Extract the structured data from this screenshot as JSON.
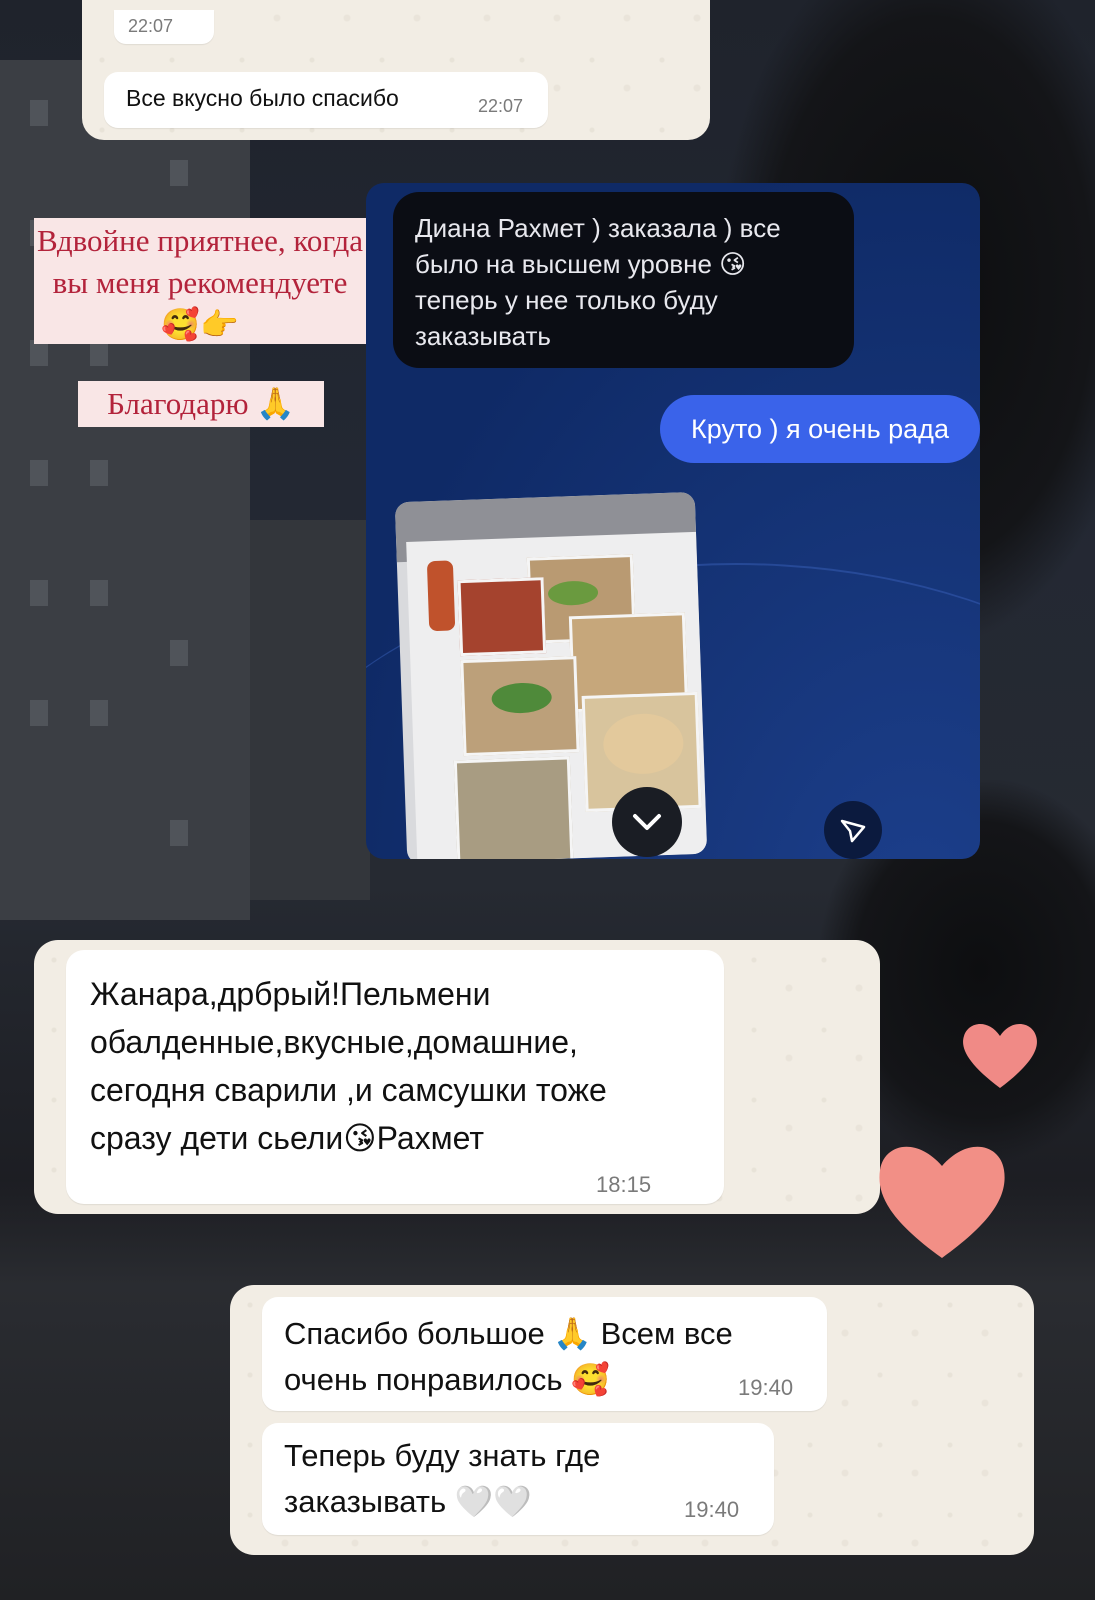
{
  "top_chat": {
    "time_top": "22:07",
    "message": "Все вкусно было спасибо",
    "message_time": "22:07"
  },
  "captions": {
    "recommend": "Вдвойне приятнее, когда вы меня рекомендуете🥰👉",
    "thanks": "Благодарю 🙏"
  },
  "dm_chat": {
    "received": "Диана Рахмет ) заказала ) все было на высшем уровне 😘 теперь у нее только буду заказывать",
    "sent": "Круто ) я очень рада",
    "scroll_down_icon": "chevron-down-icon",
    "send_icon": "send-icon"
  },
  "middle_chat": {
    "message": "Жанара,дрбрый!Пельмени обалденные,вкусные,домашние, сегодня сварили ,и самсушки тоже  сразу дети сьели😘Рахмет",
    "time": "18:15"
  },
  "bottom_chat": {
    "message1": "Спасибо большое 🙏 Всем все очень понравилось 🥰",
    "time1": "19:40",
    "message2": "Теперь буду знать где заказывать 🤍🤍",
    "time2": "19:40"
  },
  "colors": {
    "caption_text": "#b3233b",
    "caption_bg": "#f9e6e6",
    "dm_sent_bubble": "#3a63ea",
    "heart": "#f08a86"
  }
}
